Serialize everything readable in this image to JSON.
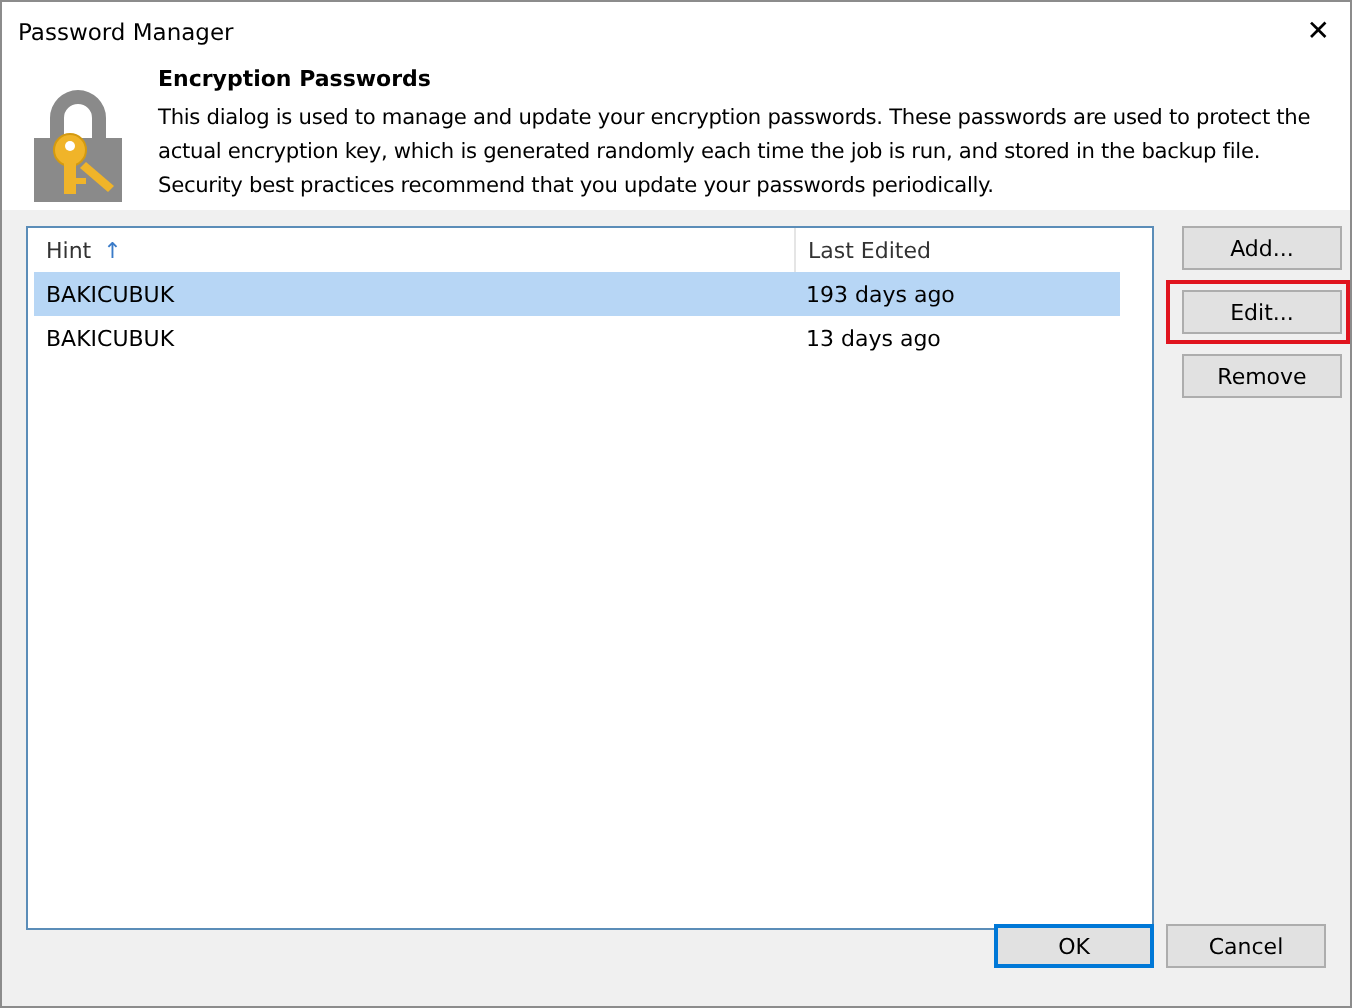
{
  "window": {
    "title": "Password Manager",
    "close": "✕"
  },
  "header": {
    "title": "Encryption Passwords",
    "description": "This dialog is used to manage and update your encryption passwords. These passwords are used to protect the actual encryption key, which is generated randomly each time the job is run, and stored in the backup file. Security best practices recommend that you update your passwords periodically."
  },
  "table": {
    "columns": [
      {
        "label": "Hint",
        "sort": "↑"
      },
      {
        "label": "Last Edited"
      }
    ],
    "rows": [
      {
        "cells": [
          "BAKICUBUK",
          "193 days ago"
        ],
        "selected": true
      },
      {
        "cells": [
          "BAKICUBUK",
          "13 days ago"
        ],
        "selected": false
      }
    ]
  },
  "side_buttons": [
    {
      "label": "Add...",
      "highlighted": false
    },
    {
      "label": "Edit...",
      "highlighted": true
    },
    {
      "label": "Remove",
      "highlighted": false
    }
  ],
  "footer_buttons": [
    {
      "label": "OK",
      "default": true
    },
    {
      "label": "Cancel",
      "default": false
    }
  ]
}
